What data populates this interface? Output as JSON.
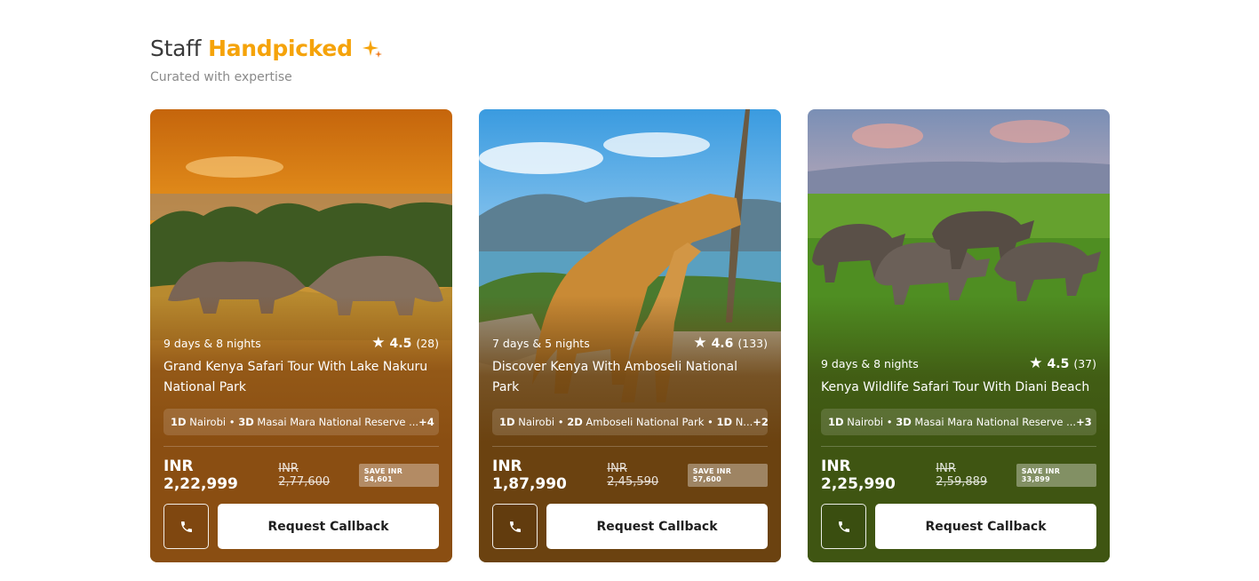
{
  "section": {
    "title_prefix": "Staff",
    "title_accent": "Handpicked",
    "subtitle": "Curated with expertise",
    "accent_color": "#f5a30a"
  },
  "cards": [
    {
      "duration": "9 days & 8 nights",
      "rating": "4.5",
      "reviews": "(28)",
      "title": "Grand Kenya Safari Tour With Lake Nakuru National Park",
      "itinerary": [
        {
          "days": "1D",
          "place": "Nairobi"
        },
        {
          "days": "3D",
          "place": "Masai Mara National Reserve ..."
        }
      ],
      "more": "+4",
      "price": "INR 2,22,999",
      "old_price": "INR 2,77,600",
      "save": "SAVE INR 54,601",
      "cta": "Request Callback",
      "image_subject": "rhinos at sunset",
      "overlay_color": "#8a4e12"
    },
    {
      "duration": "7 days & 5 nights",
      "rating": "4.6",
      "reviews": "(133)",
      "title": "Discover Kenya With Amboseli National Park",
      "itinerary": [
        {
          "days": "1D",
          "place": "Nairobi"
        },
        {
          "days": "2D",
          "place": "Amboseli National Park"
        },
        {
          "days": "1D",
          "place": "N..."
        }
      ],
      "more": "+2",
      "price": "INR 1,87,990",
      "old_price": "INR 2,45,590",
      "save": "SAVE INR 57,600",
      "cta": "Request Callback",
      "image_subject": "giraffes",
      "overlay_color": "#6b4210"
    },
    {
      "duration": "9 days & 8 nights",
      "rating": "4.5",
      "reviews": "(37)",
      "title": "Kenya Wildlife Safari Tour With Diani Beach",
      "itinerary": [
        {
          "days": "1D",
          "place": "Nairobi"
        },
        {
          "days": "3D",
          "place": "Masai Mara National Reserve ..."
        }
      ],
      "more": "+3",
      "price": "INR 2,25,990",
      "old_price": "INR 2,59,889",
      "save": "SAVE INR 33,899",
      "cta": "Request Callback",
      "image_subject": "wildebeest on grassland",
      "overlay_color": "#3f5512"
    }
  ]
}
